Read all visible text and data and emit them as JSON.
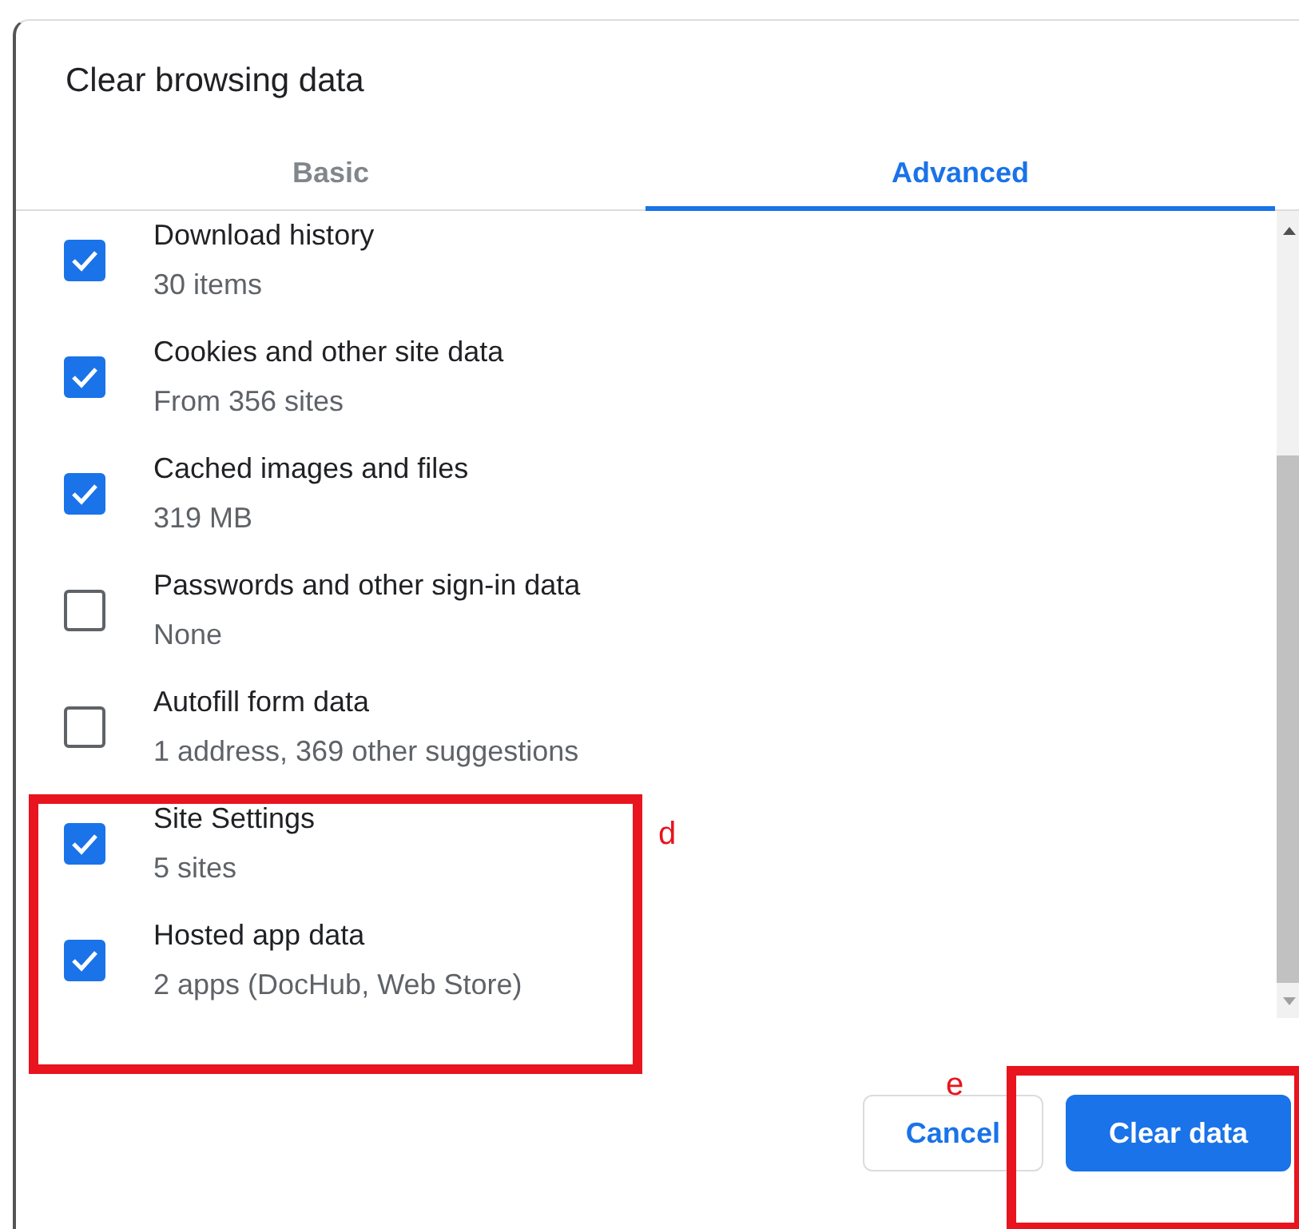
{
  "dialog": {
    "title": "Clear browsing data"
  },
  "tabs": [
    {
      "label": "Basic",
      "selected": false
    },
    {
      "label": "Advanced",
      "selected": true
    }
  ],
  "items": [
    {
      "title": "Download history",
      "detail": "30 items",
      "checked": true
    },
    {
      "title": "Cookies and other site data",
      "detail": "From 356 sites",
      "checked": true
    },
    {
      "title": "Cached images and files",
      "detail": "319 MB",
      "checked": true
    },
    {
      "title": "Passwords and other sign-in data",
      "detail": "None",
      "checked": false
    },
    {
      "title": "Autofill form data",
      "detail": "1 address, 369 other suggestions",
      "checked": false
    },
    {
      "title": "Site Settings",
      "detail": "5 sites",
      "checked": true
    },
    {
      "title": "Hosted app data",
      "detail": "2 apps (DocHub, Web Store)",
      "checked": true
    }
  ],
  "buttons": [
    {
      "label": "Cancel",
      "kind": "secondary"
    },
    {
      "label": "Clear data",
      "kind": "primary"
    }
  ],
  "annotations": [
    {
      "label": "d"
    },
    {
      "label": "e"
    }
  ]
}
